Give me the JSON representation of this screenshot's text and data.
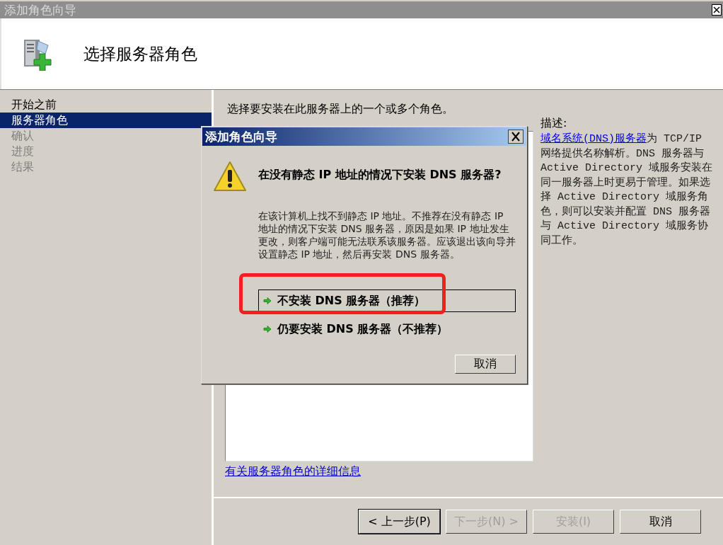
{
  "window": {
    "title": "添加角色向导"
  },
  "header": {
    "title": "选择服务器角色"
  },
  "steps": [
    {
      "label": "开始之前",
      "selected": false,
      "disabled": false
    },
    {
      "label": "服务器角色",
      "selected": true,
      "disabled": false
    },
    {
      "label": "确认",
      "selected": false,
      "disabled": true
    },
    {
      "label": "进度",
      "selected": false,
      "disabled": true
    },
    {
      "label": "结果",
      "selected": false,
      "disabled": true
    }
  ],
  "content": {
    "instruction": "选择要安装在此服务器上的一个或多个角色。",
    "more_info_link": "有关服务器角色的详细信息"
  },
  "description": {
    "label": "描述:",
    "link": "域名系统(DNS)服务器",
    "text": "为 TCP/IP 网络提供名称解析。DNS 服务器与 Active Directory 域服务安装在同一服务器上时更易于管理。如果选择 Active Directory 域服务角色，则可以安装并配置 DNS 服务器与 Active Directory 域服务协同工作。"
  },
  "buttons": [
    {
      "label": "< 上一步(P)",
      "disabled": false,
      "default": true
    },
    {
      "label": "下一步(N) >",
      "disabled": true,
      "default": false
    },
    {
      "label": "安装(I)",
      "disabled": true,
      "default": false
    },
    {
      "label": "取消",
      "disabled": false,
      "default": false
    }
  ],
  "dialog": {
    "title": "添加角色向导",
    "heading": "在没有静态 IP 地址的情况下安装 DNS 服务器?",
    "message": "在该计算机上找不到静态 IP 地址。不推荐在没有静态 IP 地址的情况下安装 DNS 服务器，原因是如果 IP 地址发生更改，则客户端可能无法联系该服务器。应该退出该向导并设置静态 IP 地址，然后再安装 DNS 服务器。",
    "options": [
      {
        "label": "不安装 DNS 服务器（推荐）",
        "selected": true
      },
      {
        "label": "仍要安装 DNS 服务器（不推荐）",
        "selected": false
      }
    ],
    "cancel": "取消"
  }
}
